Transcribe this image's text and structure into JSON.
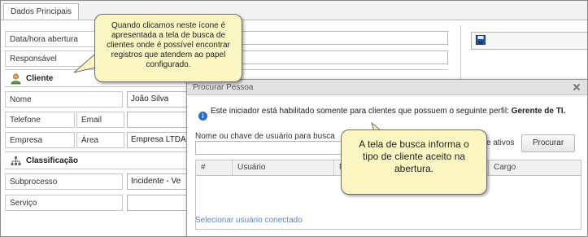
{
  "tabs": {
    "main": "Dados Principais"
  },
  "form": {
    "data_hora_label": "Data/hora abertura",
    "responsavel_label": "Responsável",
    "cliente_section": "Cliente",
    "nome_label": "Nome",
    "nome_value": "João Silva",
    "telefone_label": "Telefone",
    "email_label": "Email",
    "empresa_label": "Empresa",
    "area_label": "Área",
    "empresa_value": "Empresa LTDA",
    "classificacao_section": "Classificação",
    "subprocesso_label": "Subprocesso",
    "subprocesso_value": "Incidente - Ve",
    "servico_label": "Serviço"
  },
  "dialog": {
    "title": "Procurar Pessoa",
    "info_text": "Este iniciador está habilitado somente para clientes que possuem o seguinte perfil:",
    "info_profile": "Gerente de TI.",
    "search_label": "Nome ou chave de usuário para busca",
    "ativos_text": "e ativos",
    "search_button": "Procurar",
    "columns": [
      "#",
      "Usuário",
      "N",
      "Cargo"
    ],
    "footer_link": "Selecionar usuário conectado"
  },
  "callouts": {
    "top": "Quando clicamos neste ícone é apresentada a tela de busca de clientes onde é possível encontrar registros que atendem ao papel configurado.",
    "bottom": "A tela de busca informa o tipo de cliente aceito na abertura."
  },
  "colors": {
    "callout_bg": "#fbf6c2",
    "link": "#5d88c4",
    "info": "#2f6fc2"
  },
  "icons": {
    "cliente": "person-icon",
    "classificacao": "hierarchy-icon",
    "save": "floppy-disk-icon",
    "close": "close-icon",
    "info": "info-icon"
  }
}
